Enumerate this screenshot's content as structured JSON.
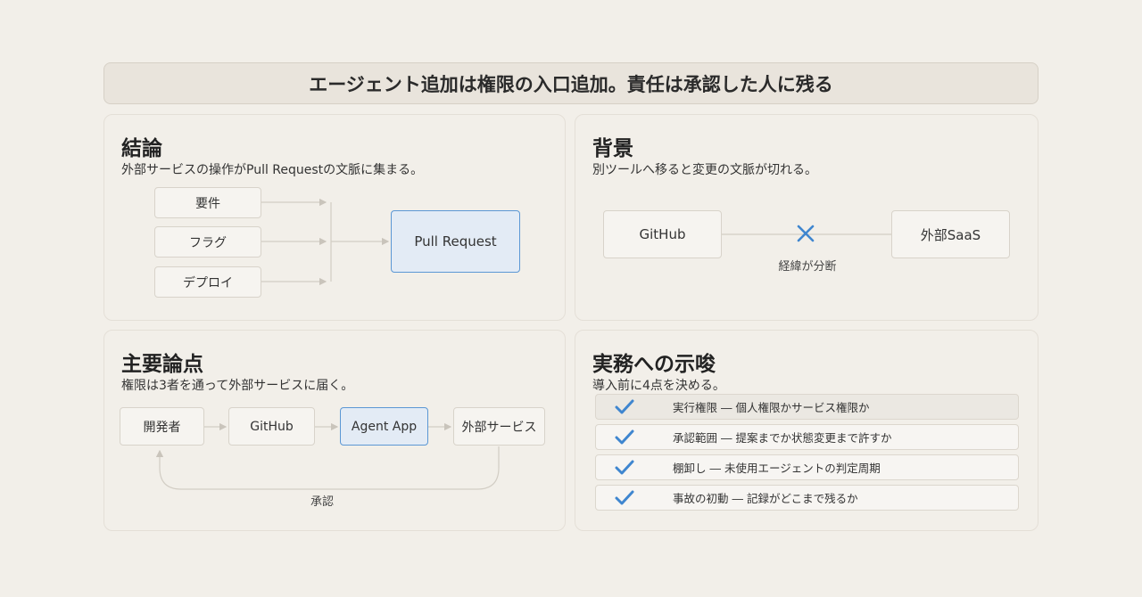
{
  "banner": {
    "title": "エージェント追加は権限の入口追加。責任は承認した人に残る"
  },
  "conclusion": {
    "title": "結論",
    "subtitle": "外部サービスの操作がPull Requestの文脈に集まる。",
    "inputs": [
      "要件",
      "フラグ",
      "デプロイ"
    ],
    "target": "Pull Request"
  },
  "background": {
    "title": "背景",
    "subtitle": "別ツールへ移ると変更の文脈が切れる。",
    "left": "GitHub",
    "right": "外部SaaS",
    "break_label": "経緯が分断"
  },
  "points": {
    "title": "主要論点",
    "subtitle": "権限は3者を通って外部サービスに届く。",
    "flow": [
      "開発者",
      "GitHub",
      "Agent App",
      "外部サービス"
    ],
    "return_label": "承認"
  },
  "implications": {
    "title": "実務への示唆",
    "subtitle": "導入前に4点を決める。",
    "items": [
      "実行権限 ― 個人権限かサービス権限か",
      "承認範囲 ― 提案までか状態変更まで許すか",
      "棚卸し ― 未使用エージェントの判定周期",
      "事故の初動 ― 記録がどこまで残るか"
    ]
  },
  "colors": {
    "accent": "#5b97d4",
    "check": "#3f86cf",
    "cross": "#3f86cf"
  }
}
